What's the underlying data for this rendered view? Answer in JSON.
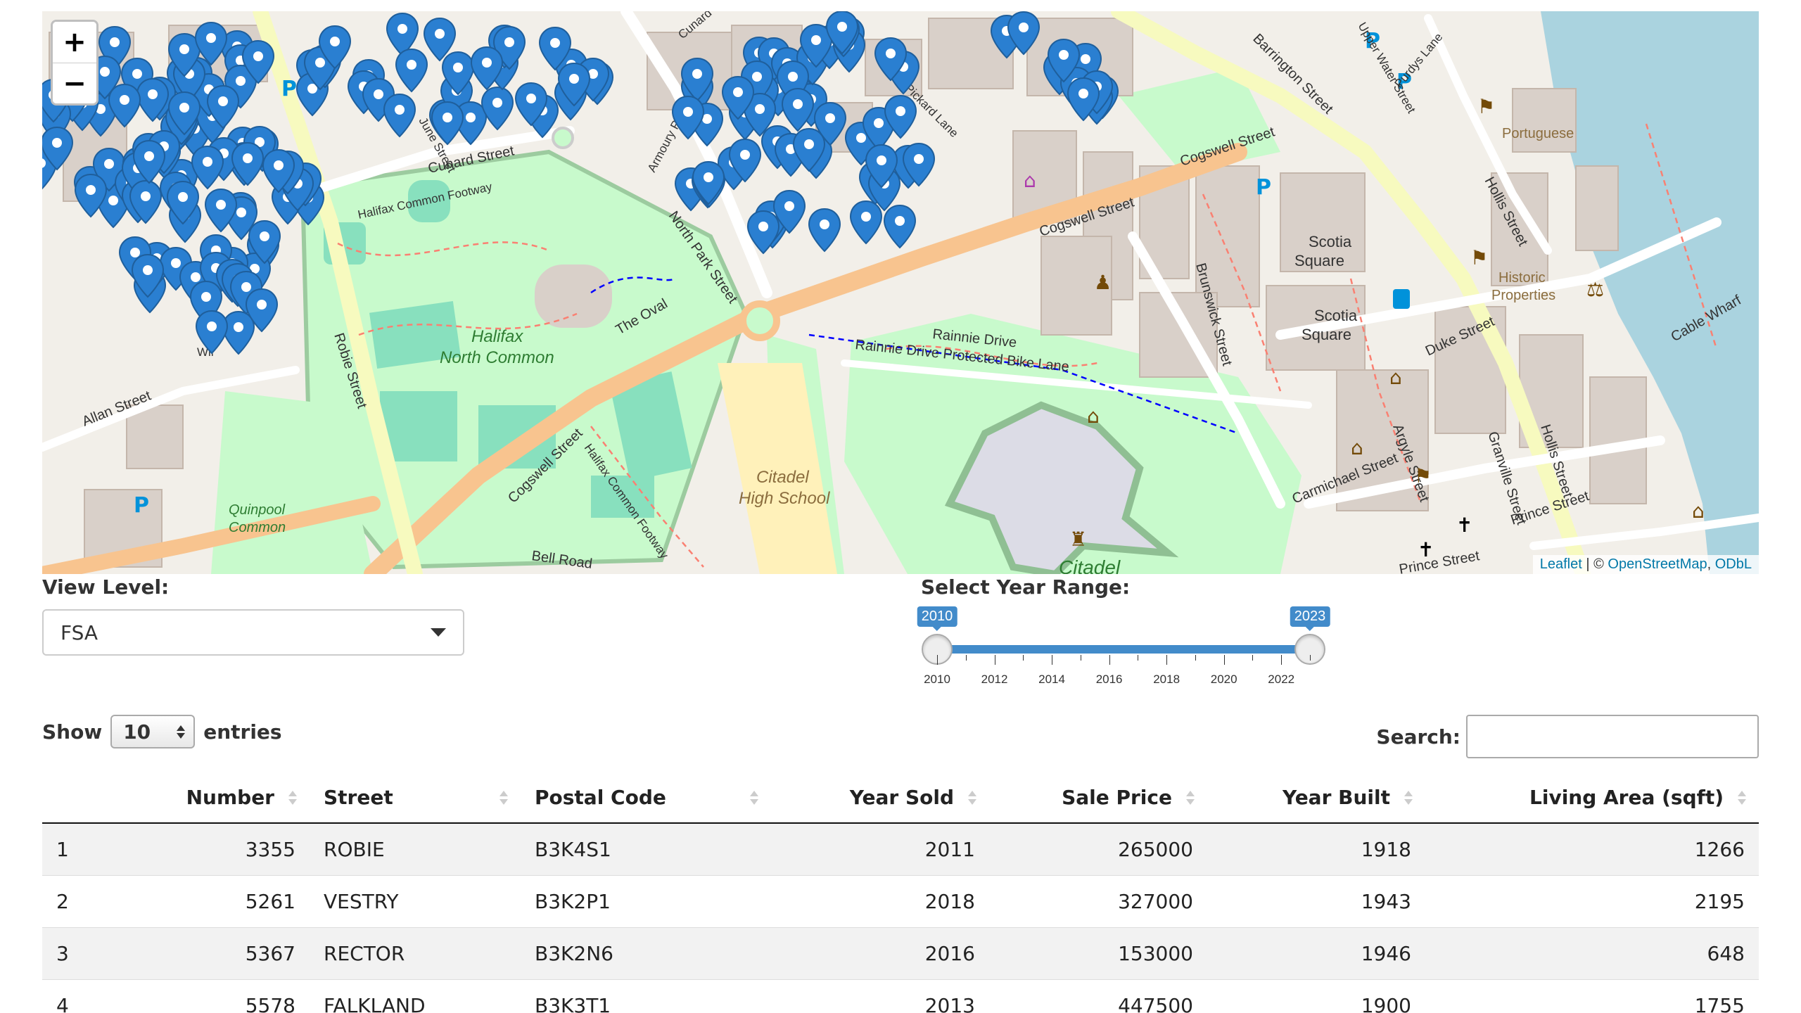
{
  "map": {
    "zoom_in": "+",
    "zoom_out": "−",
    "attribution": {
      "leaflet": "Leaflet",
      "sep": " | © ",
      "osm": "OpenStreetMap",
      "comma": ", ",
      "odbl": "ODbL"
    },
    "street_labels": [
      "Cunard Street",
      "Halifax Common Footway",
      "Halifax North Common",
      "The Oval",
      "North Park Street",
      "Cogswell Street",
      "Robie Street",
      "Allan Street",
      "Quinpool Common",
      "Bell Road",
      "Halifax Common Footway",
      "Citadel High School",
      "Rainnie Drive",
      "Rainnie Drive Protected Bike Lane",
      "Citadel",
      "Brunswick Street",
      "Scotia Square",
      "Scotia Square",
      "Barrington Street",
      "Upper Water Street",
      "Purdys Lane",
      "Hollis Street",
      "Portuguese",
      "Historic Properties",
      "Cable Wharf",
      "Duke Street",
      "Argyle Street",
      "Granville Street",
      "Hollis Street",
      "Carmichael Street",
      "Prince Street",
      "Pickard Lane",
      "Armoury Place",
      "June Street",
      "Cunard",
      "Wil"
    ],
    "marker_color": "#2a7fd1"
  },
  "view_level": {
    "label": "View Level:",
    "selected": "FSA"
  },
  "year_range": {
    "label": "Select Year Range:",
    "min": 2010,
    "max": 2023,
    "from": 2010,
    "to": 2023,
    "ticks": [
      "2010",
      "2012",
      "2014",
      "2016",
      "2018",
      "2020",
      "2022"
    ],
    "from_label": "2010",
    "to_label": "2023"
  },
  "table_controls": {
    "show": "Show",
    "entries_value": "10",
    "entries": "entries",
    "search_label": "Search:",
    "search_value": ""
  },
  "table": {
    "columns": [
      "",
      "Number",
      "Street",
      "Postal Code",
      "Year Sold",
      "Sale Price",
      "Year Built",
      "Living Area (sqft)"
    ],
    "rows": [
      [
        "1",
        "3355",
        "ROBIE",
        "B3K4S1",
        "2011",
        "265000",
        "1918",
        "1266"
      ],
      [
        "2",
        "5261",
        "VESTRY",
        "B3K2P1",
        "2018",
        "327000",
        "1943",
        "2195"
      ],
      [
        "3",
        "5367",
        "RECTOR",
        "B3K2N6",
        "2016",
        "153000",
        "1946",
        "648"
      ],
      [
        "4",
        "5578",
        "FALKLAND",
        "B3K3T1",
        "2013",
        "447500",
        "1900",
        "1755"
      ]
    ]
  }
}
